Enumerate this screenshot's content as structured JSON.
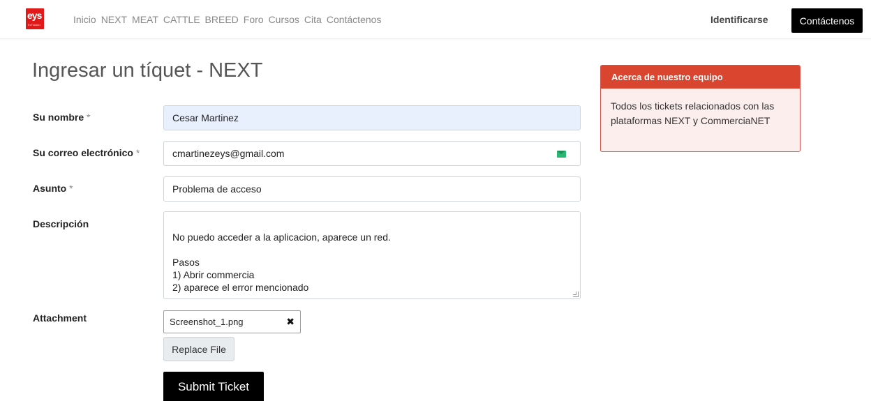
{
  "header": {
    "logo_text": "eys",
    "logo_sub": "EzTracker",
    "nav": [
      "Inicio",
      "NEXT",
      "MEAT",
      "CATTLE",
      "BREED",
      "Foro",
      "Cursos",
      "Cita",
      "Contáctenos"
    ],
    "signin": "Identificarse",
    "contact_button": "Contáctenos"
  },
  "page": {
    "title": "Ingresar un tíquet - NEXT"
  },
  "form": {
    "name_label": "Su nombre",
    "name_value": "Cesar Martinez",
    "email_label": "Su correo electrónico",
    "email_value": "cmartinezeys@gmail.com",
    "subject_label": "Asunto",
    "subject_value": "Problema de acceso",
    "description_label": "Descripción",
    "description_value": "No puedo acceder a la aplicacion, aparece un red.\n\nPasos\n1) Abrir commercia\n2) aparece el error mencionado",
    "attachment_label": "Attachment",
    "attachment_file": "Screenshot_1.png",
    "replace_button": "Replace File",
    "submit_button": "Submit Ticket",
    "required_mark": "*"
  },
  "sidebar_card": {
    "title": "Acerca de nuestro equipo",
    "body": "Todos los tickets relacionados con las plataformas NEXT y CommerciaNET"
  },
  "colors": {
    "accent_red": "#d9452f",
    "black_button": "#000000",
    "autofill_bg": "#e8f0fe"
  }
}
